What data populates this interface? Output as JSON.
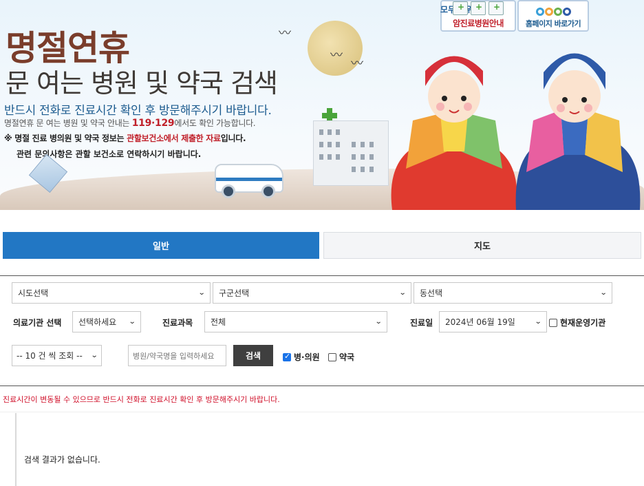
{
  "banner": {
    "title_main": "명절연휴",
    "title_sub": "문 여는 병원 및 약국 검색",
    "line1": "반드시 전화로 진료시간 확인 후 방문해주시기 바랍니다.",
    "line2_pre": "명절연휴 문 여는 병원 및 약국 안내는 ",
    "line2_hl": "119·129",
    "line2_post": "에서도 확인 가능합니다.",
    "line3_pre": "※ 명절 진료 병의원 및 약국 정보는 ",
    "line3_red": "관할보건소에서 제출한 자료",
    "line3_post": "입니다.",
    "line4": "관련 문의사항은 관할 보건소로 연락하시기 바랍니다.",
    "top_label": "모두를 위한",
    "cancer_link": "암진료병원안내",
    "homepage_link": "홈페이지 바로가기"
  },
  "tabs": [
    {
      "label": "일반",
      "active": true
    },
    {
      "label": "지도",
      "active": false
    }
  ],
  "filters": {
    "sido": "시도선택",
    "gugun": "구군선택",
    "dong": "동선택",
    "institution_label": "의료기관 선택",
    "institution_value": "선택하세요",
    "dept_label": "진료과목",
    "dept_value": "전체",
    "date_label": "진료일",
    "date_value": "2024년 06월 19일",
    "open_now_label": "현재운영기관",
    "page_size": "-- 10 건 씩 조회 --",
    "name_placeholder": "병원/약국명을 입력하세요",
    "search_button": "검색",
    "hospital_label": "병·의원",
    "pharmacy_label": "약국",
    "hospital_checked": true,
    "pharmacy_checked": false,
    "open_now_checked": false
  },
  "notice": "진료시간이 변동될 수 있으므로 반드시 전화로 진료시간 확인 후 방문해주시기 바랍니다.",
  "result": {
    "empty_message": "검색 결과가 없습니다."
  },
  "colors": {
    "active_tab": "#2277c4",
    "notice_red": "#d0102a",
    "title_brown": "#7a3d2b"
  }
}
